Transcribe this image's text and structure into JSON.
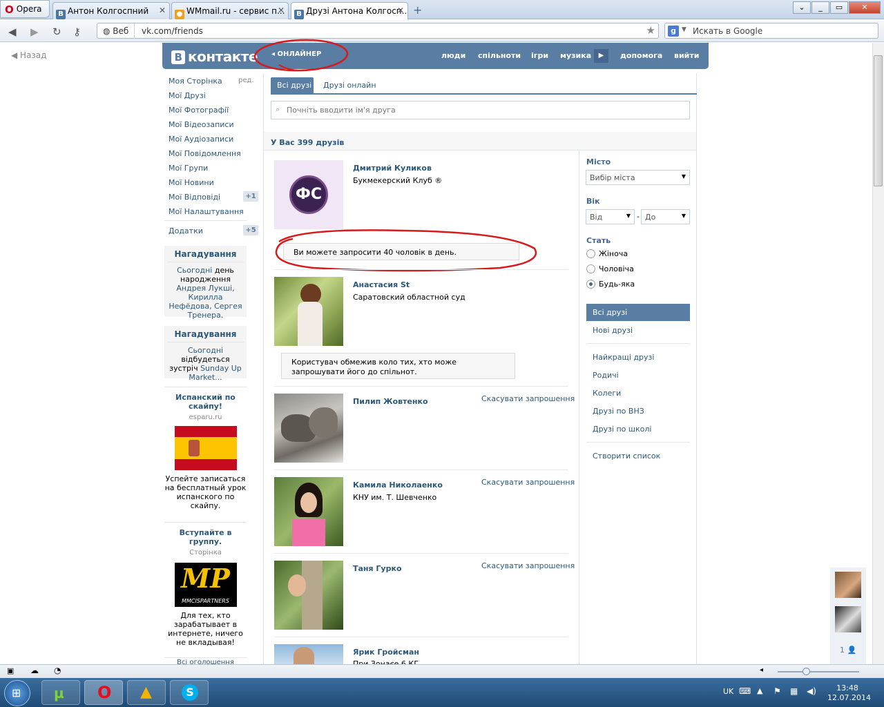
{
  "browser": {
    "menu_label": "Opera",
    "tabs": [
      {
        "title": "Антон Колгоспний",
        "icon": "vk-icon"
      },
      {
        "title": "WMmail.ru - сервис п...",
        "icon": "wmmail-icon"
      },
      {
        "title": "Друзі Антона Колгосп...",
        "icon": "vk-icon",
        "active": true
      }
    ],
    "address_prefix": "Веб",
    "url": "vk.com/friends",
    "search_placeholder": "Искать в Google"
  },
  "page": {
    "back_label": "Назад",
    "logo_text": "контакте",
    "logo_letter": "B",
    "onliner": "ОНЛАЙНЕР",
    "topnav": [
      "люди",
      "спільноти",
      "ігри",
      "музика",
      "допомога",
      "вийти"
    ],
    "left_menu": [
      {
        "label": "Моя Сторінка",
        "extra": "ред."
      },
      {
        "label": "Мої Друзі"
      },
      {
        "label": "Мої Фотографії"
      },
      {
        "label": "Мої Відеозаписи"
      },
      {
        "label": "Мої Аудіозаписи"
      },
      {
        "label": "Мої Повідомлення"
      },
      {
        "label": "Мої Групи"
      },
      {
        "label": "Мої Новини"
      },
      {
        "label": "Мої Відповіді",
        "badge": "+1"
      },
      {
        "label": "Мої Налаштування"
      },
      {
        "label": "Додатки",
        "badge": "+5"
      }
    ],
    "reminders": [
      {
        "title": "Нагадування",
        "link1": "Сьогодні",
        "text1": "день народження",
        "link2": "Андрея Лукші, Кирилла Нефёдова, Сергея Тренера",
        "tail": "."
      },
      {
        "title": "Нагадування",
        "link1": "Сьогодні",
        "text1": "відбудеться зустріч",
        "link2": "Sunday Up Market..."
      }
    ],
    "ads": [
      {
        "title": "Испанский по скайпу!",
        "site": "esparu.ru",
        "desc": "Успейте записаться на бесплатный урок испанского по скайпу."
      },
      {
        "title": "Вступайте в группу.",
        "site": "Сторінка",
        "desc": "Для тех, кто зарабатывает в интернете, ничего не вкладывая!",
        "logo_text": "MP",
        "logo_sub": "MMCISPARTNERS"
      }
    ],
    "ads_more": "Всі оголошення",
    "tabs": [
      "Всі друзі",
      "Друзі онлайн"
    ],
    "search_placeholder": "Почніть вводити ім'я друга",
    "count_text": "У Вас 399 друзів",
    "friends": [
      {
        "name": "Дмитрий Куликов",
        "sub": "Букмекерский Клуб ®",
        "notice": "Ви можете запросити 40 чоловік в день."
      },
      {
        "name": "Анастасия St",
        "sub": "Саратовский областной суд",
        "notice": "Користувач обмежив коло тих, хто може запрошувати його до спільнот."
      },
      {
        "name": "Пилип Жовтенко",
        "sub": "",
        "action": "Скасувати запрошення"
      },
      {
        "name": "Камила Николаенко",
        "sub": "КНУ им. Т. Шевченко",
        "action": "Скасувати запрошення"
      },
      {
        "name": "Таня Гурко",
        "sub": "",
        "action": "Скасувати запрошення"
      },
      {
        "name": "Ярик Гройсман",
        "sub": "При Зонаєе 6 КГ"
      }
    ],
    "filters": {
      "city_label": "Місто",
      "city_value": "Вибір міста",
      "age_label": "Вік",
      "age_from": "Від",
      "age_to": "До",
      "age_dash": "-",
      "sex_label": "Стать",
      "sex_options": [
        "Жіноча",
        "Чоловіча",
        "Будь-яка"
      ],
      "sex_selected": "Будь-яка",
      "lists": [
        "Всі друзі",
        "Нові друзі",
        "Найкращі друзі",
        "Родичі",
        "Колеги",
        "Друзі по ВНЗ",
        "Друзі по школі",
        "Створити список"
      ]
    },
    "chat_count": "1"
  },
  "taskbar": {
    "lang": "UK",
    "time": "13:48",
    "date": "12.07.2014"
  },
  "colors": {
    "vk_blue": "#597da3",
    "link": "#2b587a",
    "annotation_red": "#d81a1a"
  }
}
